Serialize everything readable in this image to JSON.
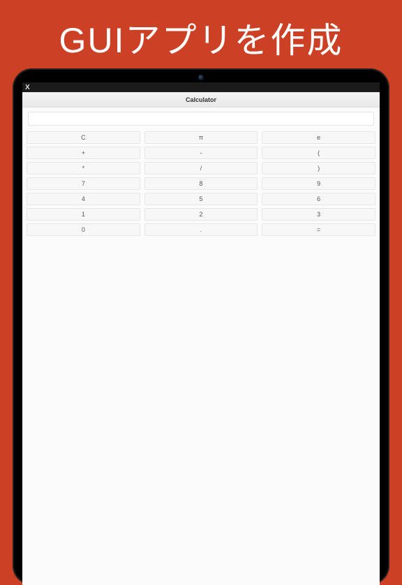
{
  "hero": "GUIアプリを作成",
  "window": {
    "close": "X"
  },
  "app": {
    "title": "Calculator",
    "display": "",
    "keys": [
      "C",
      "π",
      "e",
      "+",
      "-",
      "(",
      "*",
      "/",
      ")",
      "7",
      "8",
      "9",
      "4",
      "5",
      "6",
      "1",
      "2",
      "3",
      "0",
      ".",
      "="
    ]
  }
}
